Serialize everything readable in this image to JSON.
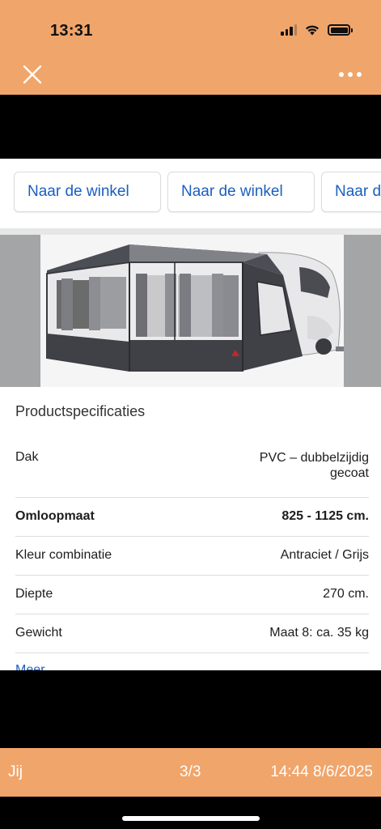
{
  "status_bar": {
    "time": "13:31",
    "icons": [
      "signal-icon",
      "wifi-icon",
      "battery-icon"
    ]
  },
  "top_bar": {
    "close_icon": "close-icon",
    "more_icon": "more-horizontal-icon",
    "color": "#f0a56b"
  },
  "shop_buttons": [
    {
      "label": "Naar de winkel"
    },
    {
      "label": "Naar de winkel"
    },
    {
      "label": "Naar de winkel"
    }
  ],
  "product": {
    "image": "awning-tent-caravan-image",
    "specs_title": "Productspecificaties",
    "specs": [
      {
        "label": "Dak",
        "value": "PVC – dubbelzijdig gecoat",
        "bold": false
      },
      {
        "label": "Omloopmaat",
        "value": "825 - 1125 cm.",
        "bold": true
      },
      {
        "label": "Kleur combinatie",
        "value": "Antraciet / Grijs",
        "bold": false
      },
      {
        "label": "Diepte",
        "value": "270 cm.",
        "bold": false
      },
      {
        "label": "Gewicht",
        "value": "Maat 8: ca. 35 kg",
        "bold": false
      }
    ],
    "more_link": "Meer tonen"
  },
  "bottom_bar": {
    "sender": "Jij",
    "counter": "3/3",
    "timestamp": "14:44 8/6/2025"
  },
  "colors": {
    "accent": "#f0a56b",
    "link": "#1a5fbf"
  }
}
